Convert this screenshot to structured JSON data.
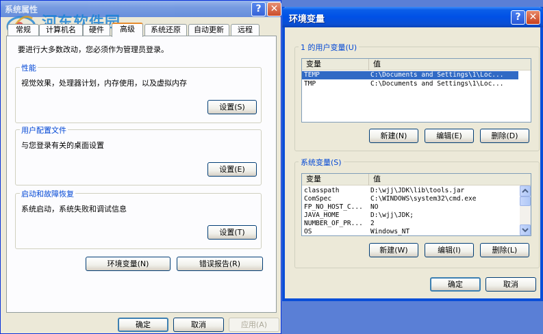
{
  "system_properties": {
    "title": "系统属性",
    "watermark": {
      "name": "河东软件园",
      "url": "www.pc0359.cn"
    },
    "tabs": [
      {
        "label": "常规"
      },
      {
        "label": "计算机名"
      },
      {
        "label": "硬件"
      },
      {
        "label": "高级",
        "active": true
      },
      {
        "label": "系统还原"
      },
      {
        "label": "自动更新"
      },
      {
        "label": "远程"
      }
    ],
    "intro": "要进行大多数改动，您必须作为管理员登录。",
    "performance": {
      "title": "性能",
      "desc": "视觉效果，处理器计划，内存使用，以及虚拟内存",
      "button": "设置(S)"
    },
    "user_profiles": {
      "title": "用户配置文件",
      "desc": "与您登录有关的桌面设置",
      "button": "设置(E)"
    },
    "startup_recovery": {
      "title": "启动和故障恢复",
      "desc": "系统启动，系统失败和调试信息",
      "button": "设置(T)"
    },
    "env_button": "环境变量(N)",
    "error_report_button": "错误报告(R)",
    "ok": "确定",
    "cancel": "取消",
    "apply": "应用(A)"
  },
  "env_vars": {
    "title": "环境变量",
    "user_group_title": "1 的用户变量(U)",
    "system_group_title": "系统变量(S)",
    "col_var": "变量",
    "col_val": "值",
    "user_vars": [
      {
        "name": "TEMP",
        "value": "C:\\Documents and Settings\\1\\Loc...",
        "selected": true
      },
      {
        "name": "TMP",
        "value": "C:\\Documents and Settings\\1\\Loc..."
      }
    ],
    "system_vars": [
      {
        "name": "classpath",
        "value": "D:\\wjj\\JDK\\lib\\tools.jar"
      },
      {
        "name": "ComSpec",
        "value": "C:\\WINDOWS\\system32\\cmd.exe"
      },
      {
        "name": "FP_NO_HOST_C...",
        "value": "NO"
      },
      {
        "name": "JAVA_HOME",
        "value": "D:\\wjj\\JDK;"
      },
      {
        "name": "NUMBER_OF_PR...",
        "value": "2"
      },
      {
        "name": "OS",
        "value": "Windows_NT"
      }
    ],
    "user_buttons": {
      "new": "新建(N)",
      "edit": "编辑(E)",
      "delete": "删除(D)"
    },
    "system_buttons": {
      "new": "新建(W)",
      "edit": "编辑(I)",
      "delete": "删除(L)"
    },
    "ok": "确定",
    "cancel": "取消"
  },
  "colors": {
    "accent": "#0046d5",
    "titlebar": "#0050e6",
    "selection": "#316ac5"
  }
}
